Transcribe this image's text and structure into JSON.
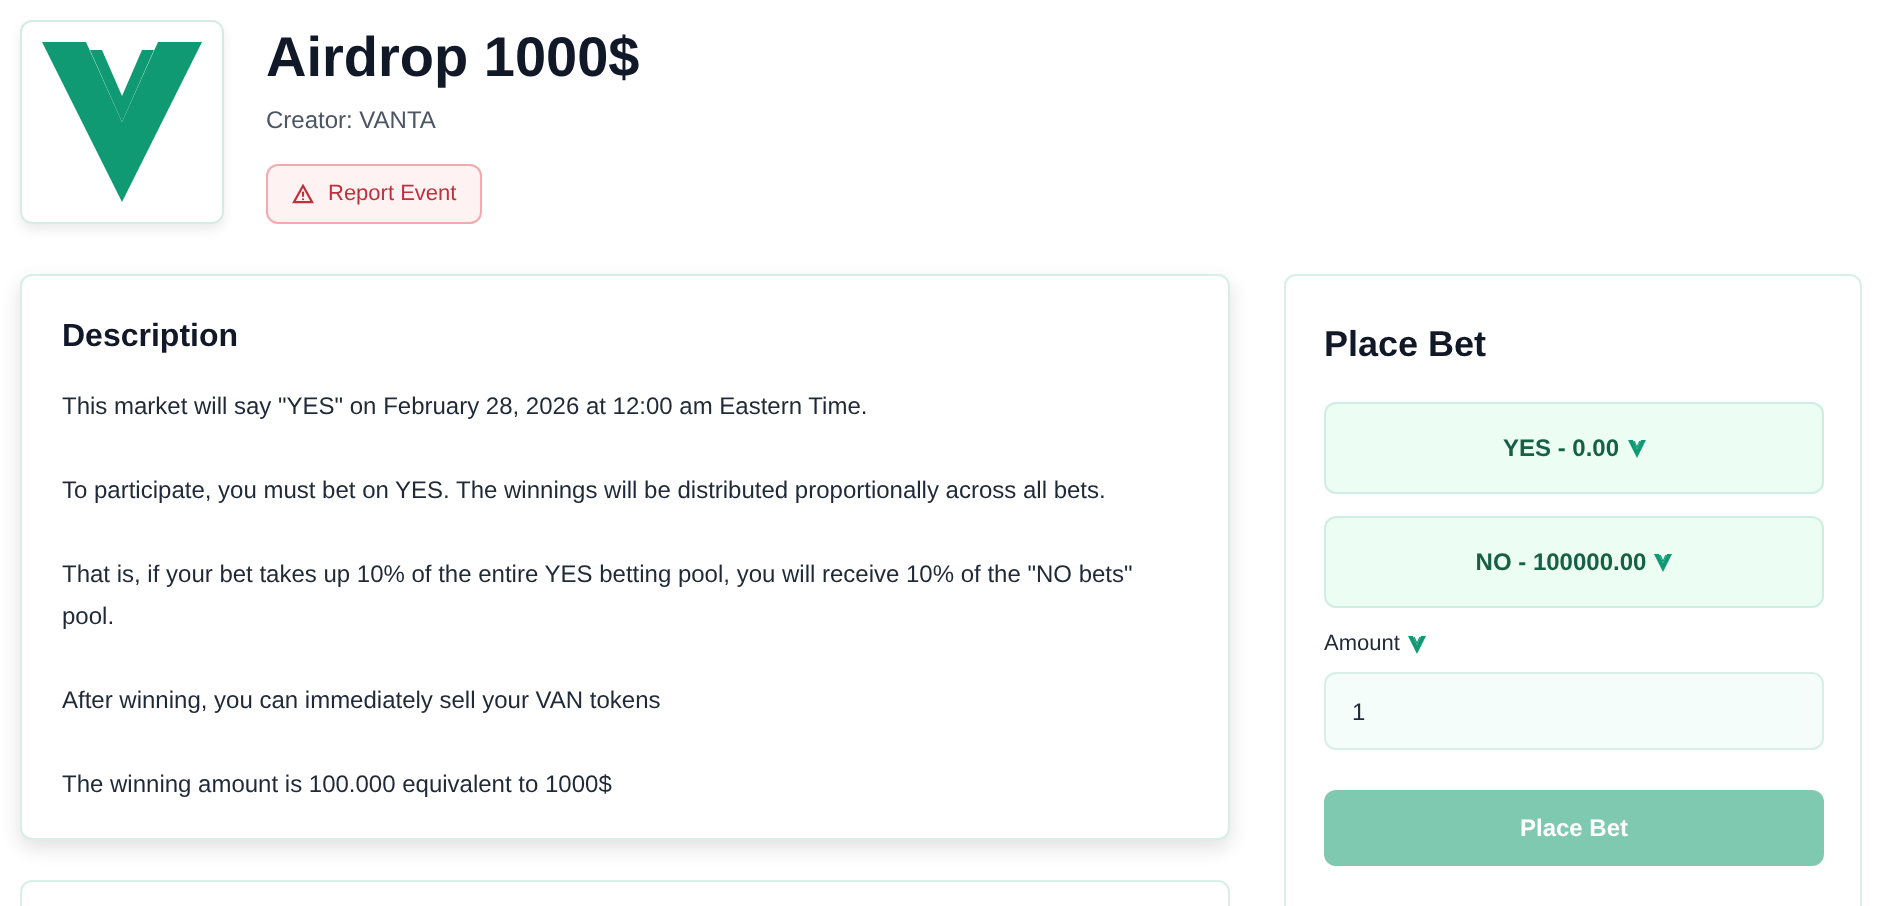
{
  "event": {
    "title": "Airdrop 1000$",
    "creator": "Creator: VANTA",
    "report_button": "Report Event"
  },
  "description": {
    "heading": "Description",
    "paragraphs": [
      "This market will say \"YES\" on February 28, 2026 at 12:00 am Eastern Time.",
      "To participate, you must bet on YES. The winnings will be distributed proportionally across all bets.",
      "That is, if your bet takes up 10% of the entire YES betting pool, you will receive 10% of the \"NO bets\" pool.",
      "After winning, you can immediately sell your VAN tokens",
      "The winning amount is 100.000 equivalent to 1000$"
    ]
  },
  "bet_panel": {
    "heading": "Place Bet",
    "outcomes": [
      {
        "label": "YES - 0.00"
      },
      {
        "label": "NO - 100000.00"
      }
    ],
    "amount_label": "Amount",
    "amount_value": "1",
    "submit": {
      "label": "Place Bet",
      "disabled": true
    }
  }
}
